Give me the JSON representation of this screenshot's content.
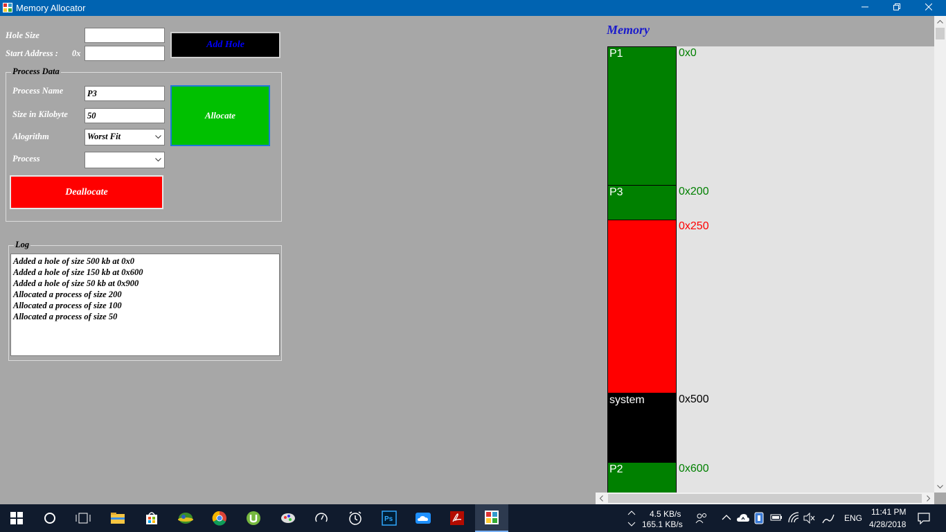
{
  "window": {
    "title": "Memory Allocator",
    "minimize": "—",
    "restore": "❐",
    "close": "✕"
  },
  "hole": {
    "size_label": "Hole Size",
    "size_value": "",
    "start_label": "Start Address :",
    "start_prefix": "0x",
    "start_value": "",
    "add_button": "Add Hole"
  },
  "process": {
    "group_title": "Process Data",
    "name_label": "Process Name",
    "name_value": "P3",
    "size_label": "Size in Kilobyte",
    "size_value": "50",
    "algorithm_label": "Alogrithm",
    "algorithm_value": "Worst Fit",
    "process_label": "Process",
    "process_value": "",
    "allocate_button": "Allocate",
    "deallocate_button": "Deallocate"
  },
  "log": {
    "title": "Log",
    "lines": [
      "Added a hole of size 500 kb at 0x0",
      "Added a hole of size 150 kb at 0x600",
      "Added a hole of size 50 kb at 0x900",
      "Allocated a process of size 200",
      "Allocated a process of size 100",
      "Allocated a process of size 50"
    ]
  },
  "memory": {
    "title": "Memory",
    "blocks": [
      {
        "label": "P1",
        "address": "0x0",
        "color": "#008000",
        "addr_color": "#008000"
      },
      {
        "label": "P3",
        "address": "0x200",
        "color": "#008000",
        "addr_color": "#008000"
      },
      {
        "label": "",
        "address": "0x250",
        "color": "#ff0000",
        "addr_color": "#ff0000"
      },
      {
        "label": "system",
        "address": "0x500",
        "color": "#000000",
        "addr_color": "#000000"
      },
      {
        "label": "P2",
        "address": "0x600",
        "color": "#008000",
        "addr_color": "#008000"
      }
    ]
  },
  "colors": {
    "add_hole_bg": "#000000",
    "add_hole_text": "#0000ff",
    "allocate_bg": "#00c000",
    "deallocate_bg": "#ff0000",
    "titlebar": "#0063b1"
  },
  "taskbar": {
    "net_up": "4.5 KB/s",
    "net_down": "165.1 KB/s",
    "language": "ENG",
    "time": "11:41 PM",
    "date": "4/28/2018",
    "apps": [
      "start-icon",
      "cortana-icon",
      "task-view-icon",
      "file-explorer-icon",
      "store-icon",
      "network-app-icon",
      "chrome-icon",
      "utorrent-icon",
      "paint-app-icon",
      "speedometer-icon",
      "alarm-clock-icon",
      "photoshop-icon",
      "onedrive-icon",
      "acrobat-icon",
      "memory-allocator-icon"
    ]
  }
}
